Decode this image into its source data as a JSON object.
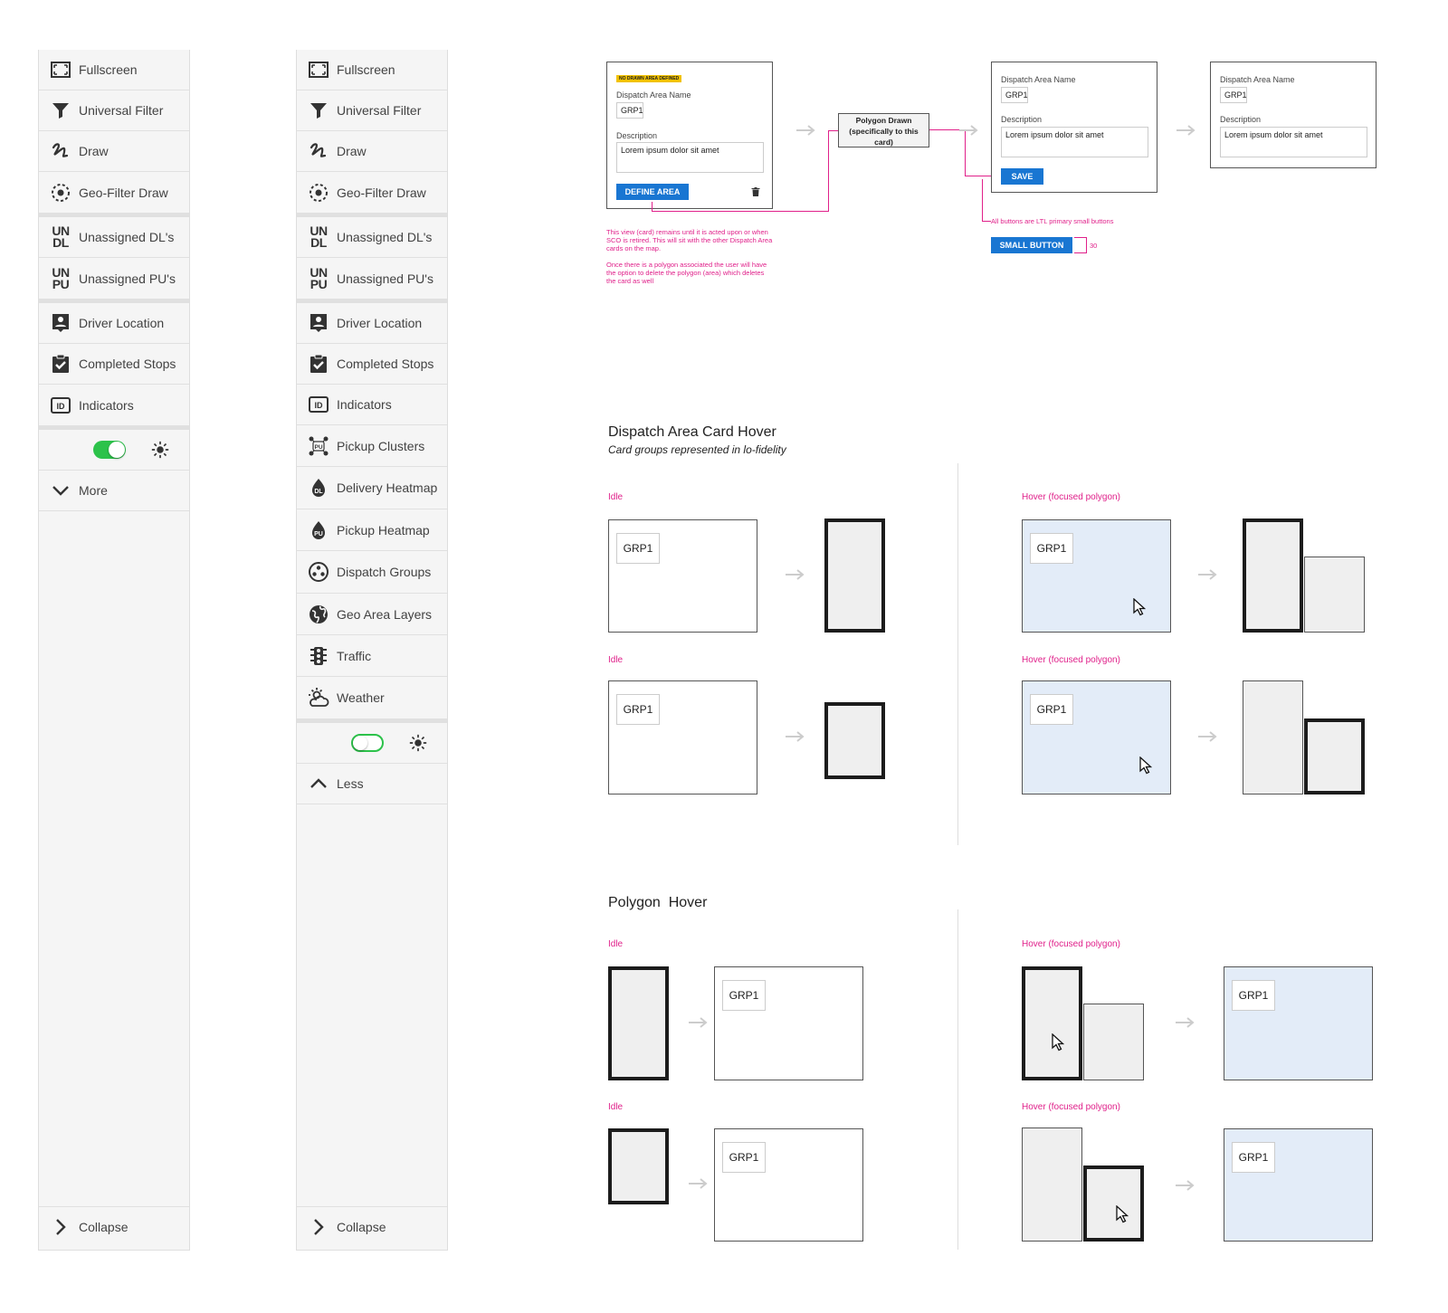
{
  "sidebar_collapsed": {
    "items": [
      {
        "label": "Fullscreen",
        "icon": "fullscreen-icon"
      },
      {
        "label": "Universal Filter",
        "icon": "filter-icon"
      },
      {
        "label": "Draw",
        "icon": "draw-icon"
      },
      {
        "label": "Geo-Filter Draw",
        "icon": "geo-filter-icon"
      },
      {
        "label": "Unassigned DL's",
        "icon": "unassigned-dl-icon",
        "glyph1": "UN",
        "glyph2": "DL"
      },
      {
        "label": "Unassigned PU's",
        "icon": "unassigned-pu-icon",
        "glyph1": "UN",
        "glyph2": "PU"
      },
      {
        "label": "Driver Location",
        "icon": "driver-location-icon"
      },
      {
        "label": "Completed Stops",
        "icon": "completed-stops-icon"
      },
      {
        "label": "Indicators",
        "icon": "indicators-icon",
        "glyph": "ID"
      }
    ],
    "more_label": "More",
    "collapse_label": "Collapse",
    "toggle_on": true
  },
  "sidebar_expanded": {
    "items": [
      {
        "label": "Fullscreen"
      },
      {
        "label": "Universal Filter"
      },
      {
        "label": "Draw"
      },
      {
        "label": "Geo-Filter Draw"
      },
      {
        "label": "Unassigned DL's",
        "glyph1": "UN",
        "glyph2": "DL"
      },
      {
        "label": "Unassigned PU's",
        "glyph1": "UN",
        "glyph2": "PU"
      },
      {
        "label": "Driver Location"
      },
      {
        "label": "Completed Stops"
      },
      {
        "label": "Indicators",
        "glyph": "ID"
      },
      {
        "label": "Pickup Clusters",
        "glyph": "PU"
      },
      {
        "label": "Delivery Heatmap",
        "glyph": "DL"
      },
      {
        "label": "Pickup Heatmap",
        "glyph": "PU"
      },
      {
        "label": "Dispatch Groups"
      },
      {
        "label": "Geo Area Layers"
      },
      {
        "label": "Traffic"
      },
      {
        "label": "Weather"
      }
    ],
    "less_label": "Less",
    "collapse_label": "Collapse",
    "toggle_on": false
  },
  "flow": {
    "badge": "NO DRAWN AREA DEFINED",
    "name_label": "Dispatch Area Name",
    "name_value": "GRP1",
    "desc_label": "Description",
    "desc_value": "Lorem ipsum dolor sit amet",
    "define_button": "DEFINE AREA",
    "polygon_box": "Polygon Drawn (specifically to this card)",
    "save_button": "SAVE",
    "buttons_note": "All buttons are LTL primary small buttons",
    "small_button": "SMALL BUTTON",
    "small_button_height": "30",
    "note1": "This view (card) remains until it is acted upon or when SCO is retired. This will sit with the other Dispatch Area cards on the map.",
    "note2": "Once there is a polygon associated the user will have the option to delete the polygon (area) which deletes the card as well"
  },
  "card_hover": {
    "title": "Dispatch Area Card Hover",
    "subtitle": "Card groups represented in lo-fidelity",
    "idle_label": "Idle",
    "hover_label": "Hover (focused polygon)",
    "chip": "GRP1"
  },
  "polygon_hover": {
    "title": "Polygon  Hover",
    "idle_label": "Idle",
    "hover_label": "Hover (focused polygon)",
    "chip": "GRP1"
  },
  "colors": {
    "toggle_green": "#2cc24a",
    "accent_blue": "#1976d2",
    "note_pink": "#e0208a",
    "hover_blue": "#e3ecf8"
  }
}
